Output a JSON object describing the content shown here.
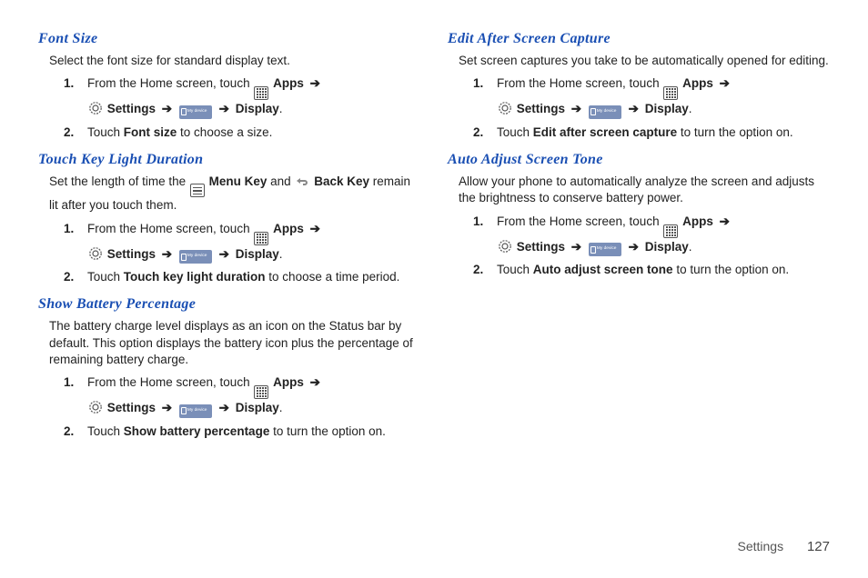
{
  "common": {
    "nav_step1_prefix": "From the Home screen, touch ",
    "apps_label": "Apps",
    "arrow": "➔",
    "settings_label": "Settings",
    "mydevice_label": "My device",
    "display_label": "Display",
    "period": ".",
    "touch_prefix": "Touch ",
    "suffix_turn_on": " to turn the option on."
  },
  "left": {
    "font_size": {
      "heading": "Font Size",
      "intro": "Select the font size for standard display text.",
      "step2_bold": "Font size",
      "step2_suffix": " to choose a size."
    },
    "touch_key": {
      "heading": "Touch Key Light Duration",
      "intro_pre": "Set the length of time the ",
      "menu_key": "Menu Key",
      "intro_mid": " and ",
      "back_key": "Back Key",
      "intro_post": " remain lit after you touch them.",
      "step2_bold": "Touch key light duration",
      "step2_suffix": " to choose a time period."
    },
    "battery": {
      "heading": "Show Battery Percentage",
      "intro": "The battery charge level displays as an icon on the Status bar by default. This option displays the battery icon plus the percentage of remaining battery charge.",
      "step2_bold": "Show battery percentage"
    }
  },
  "right": {
    "edit_capture": {
      "heading": "Edit After Screen Capture",
      "intro": "Set screen captures you take to be automatically opened for editing.",
      "step2_bold": "Edit after screen capture"
    },
    "auto_tone": {
      "heading": "Auto Adjust Screen Tone",
      "intro": "Allow your phone to automatically analyze the screen and adjusts the brightness to conserve battery power.",
      "step2_bold": "Auto adjust screen tone"
    }
  },
  "footer": {
    "section": "Settings",
    "page": "127"
  }
}
